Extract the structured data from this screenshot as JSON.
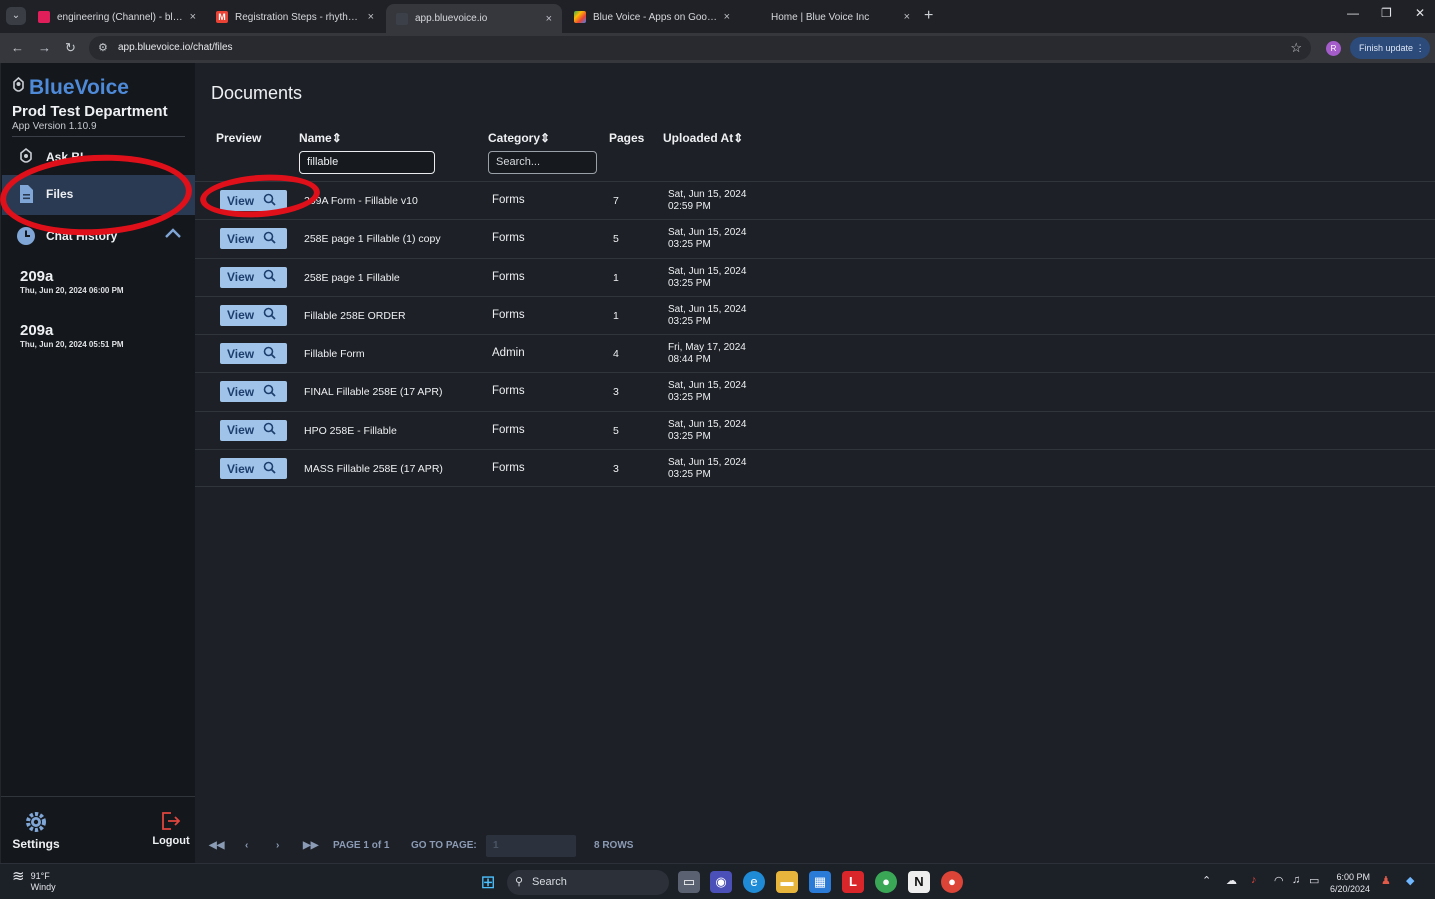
{
  "browser": {
    "tabs": [
      {
        "title": "engineering (Channel) - bluevoi",
        "close": "×"
      },
      {
        "title": "Registration Steps - rhythm@bl",
        "close": "×"
      },
      {
        "title": "app.bluevoice.io",
        "close": "×"
      },
      {
        "title": "Blue Voice - Apps on Google Pl",
        "close": "×"
      },
      {
        "title": "Home | Blue Voice Inc",
        "close": "×"
      }
    ],
    "url": "app.bluevoice.io/chat/files",
    "profile_initial": "R",
    "finish_update": "Finish update"
  },
  "sidebar": {
    "brand": "BlueVoice",
    "department": "Prod Test Department",
    "version": "App Version 1.10.9",
    "items": [
      {
        "label": "Ask BI"
      },
      {
        "label": "Files"
      },
      {
        "label": "Chat History"
      }
    ],
    "history": [
      {
        "title": "209a",
        "date": "Thu, Jun 20, 2024 06:00 PM"
      },
      {
        "title": "209a",
        "date": "Thu, Jun 20, 2024 05:51 PM"
      }
    ],
    "settings": "Settings",
    "logout": "Logout"
  },
  "main": {
    "title": "Documents",
    "columns": {
      "preview": "Preview",
      "name": "Name",
      "category": "Category",
      "pages": "Pages",
      "uploaded": "Uploaded At"
    },
    "name_filter_value": "fillable",
    "category_filter_placeholder": "Search...",
    "view_label": "View",
    "rows": [
      {
        "name": "209A Form - Fillable v10",
        "category": "Forms",
        "pages": "7",
        "date": "Sat, Jun 15, 2024",
        "time": "02:59 PM"
      },
      {
        "name": "258E page 1 Fillable (1) copy",
        "category": "Forms",
        "pages": "5",
        "date": "Sat, Jun 15, 2024",
        "time": "03:25 PM"
      },
      {
        "name": "258E page 1 Fillable",
        "category": "Forms",
        "pages": "1",
        "date": "Sat, Jun 15, 2024",
        "time": "03:25 PM"
      },
      {
        "name": "Fillable 258E ORDER",
        "category": "Forms",
        "pages": "1",
        "date": "Sat, Jun 15, 2024",
        "time": "03:25 PM"
      },
      {
        "name": "Fillable Form",
        "category": "Admin",
        "pages": "4",
        "date": "Fri, May 17, 2024",
        "time": "08:44 PM"
      },
      {
        "name": "FINAL Fillable 258E (17 APR)",
        "category": "Forms",
        "pages": "3",
        "date": "Sat, Jun 15, 2024",
        "time": "03:25 PM"
      },
      {
        "name": "HPO 258E - Fillable",
        "category": "Forms",
        "pages": "5",
        "date": "Sat, Jun 15, 2024",
        "time": "03:25 PM"
      },
      {
        "name": "MASS Fillable 258E (17 APR)",
        "category": "Forms",
        "pages": "3",
        "date": "Sat, Jun 15, 2024",
        "time": "03:25 PM"
      }
    ],
    "pager": {
      "page_text": "PAGE 1 of 1",
      "goto_label": "GO TO PAGE:",
      "goto_value": "1",
      "rows_text": "8 ROWS"
    }
  },
  "taskbar": {
    "weather_temp": "91°F",
    "weather_desc": "Windy",
    "search_label": "Search",
    "time": "6:00 PM",
    "date": "6/20/2024"
  },
  "colors": {
    "accent": "#4e8ad8",
    "view_button": "#9fc3e9",
    "annotation": "#e0101a"
  }
}
